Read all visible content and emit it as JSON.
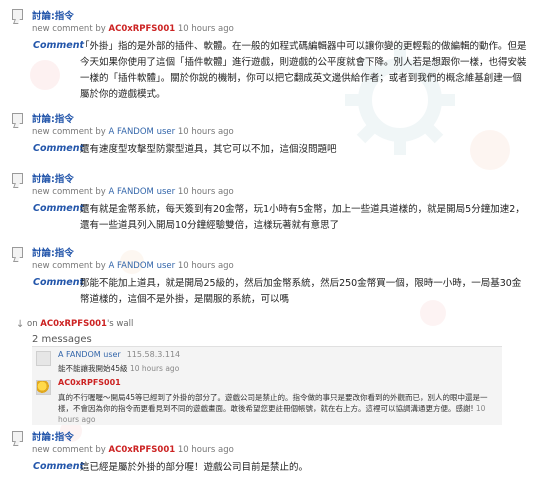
{
  "entries": [
    {
      "title": "討論:指令",
      "meta_prefix": "new comment by",
      "user": "AC0xRPFS001",
      "time": "10 hours ago",
      "comment_label": "Comment",
      "text": "「外掛」指的是外部的插件、軟體。在一般的如程式碼編輯器中可以讓你變的更輕鬆的做編輯的動作。但是今天如果你使用了這個「插件軟體」進行遊戲，則遊戲的公平度就會下降。別人若是想跟你一樣，也得安裝一樣的「插件軟體」。關於你說的機制，你可以把它翻成英文邊供給作者；或者到我們的概念維基創建一個屬於你的遊戲模式。"
    },
    {
      "title": "討論:指令",
      "meta_prefix": "new comment by",
      "user": "A FANDOM user",
      "time": "10 hours ago",
      "comment_label": "Comment",
      "text": "還有速度型攻擊型防禦型道具，其它可以不加，這個沒問題吧"
    },
    {
      "title": "討論:指令",
      "meta_prefix": "new comment by",
      "user": "A FANDOM user",
      "time": "10 hours ago",
      "comment_label": "Comment",
      "text": "還有就是金幣系統，每天簽到有20金幣，玩1小時有5金幣，加上一些道具道樣的，就是開局5分鐘加速2，還有一些道具列入開局10分鐘經驗雙倍，這樣玩著就有意思了"
    },
    {
      "title": "討論:指令",
      "meta_prefix": "new comment by",
      "user": "A FANDOM user",
      "time": "10 hours ago",
      "comment_label": "Comment",
      "text": "那能不能加上道具，就是開局25級的，然后加金幣系統，然后250金幣買一個，限時一小時，一局基30金幣道樣的，這個不是外掛，是關服的系統，可以嗎"
    }
  ],
  "wall": {
    "on": "on",
    "owner": "AC0xRPFS001",
    "suffix": "'s wall",
    "count": "2 messages",
    "msg1_user": "A FANDOM user",
    "msg1_ip": "115.58.3.114",
    "msg1_text": "能不能讓我開始45級",
    "msg1_time": "10 hours ago",
    "msg2_user": "AC0xRPFS001",
    "msg2_text": "真的不行喔喔～開局45等已經到了外掛的部分了。遊戲公司是禁止的。指令做的事只是要改你看到的外觀而已，別人的眼中還是一樣，不會因為你的指令而更看見到不同的遊戲畫面。敢後希望您更註冊個帳號，就在右上方。這裡可以協調溝通更方便。感謝!",
    "msg2_time": "10 hours ago"
  },
  "last_entry": {
    "title": "討論:指令",
    "meta_prefix": "new comment by",
    "user": "AC0xRPFS001",
    "time": "10 hours ago",
    "comment_label": "Comment",
    "text": "這已經是屬於外掛的部分喔！遊戲公司目前是禁止的。"
  },
  "colors": {
    "link": "#2255aa",
    "user_red": "#cc2222",
    "meta": "#777777"
  }
}
